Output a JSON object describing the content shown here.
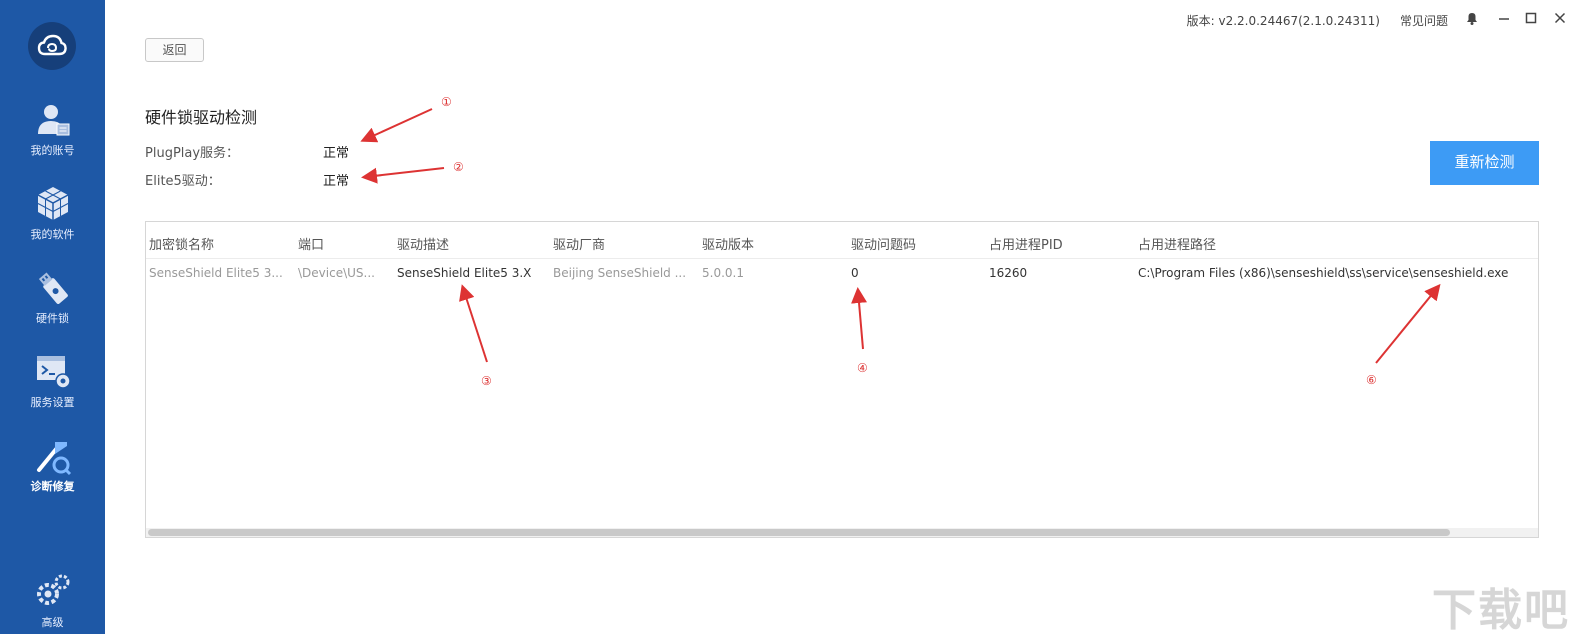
{
  "app": {
    "version": "版本: v2.2.0.24467(2.1.0.24311)",
    "faq": "常见问题"
  },
  "sidebar": {
    "items": [
      {
        "label": "我的账号",
        "icon": "user-account-icon"
      },
      {
        "label": "我的软件",
        "icon": "cube-software-icon"
      },
      {
        "label": "硬件锁",
        "icon": "usb-dongle-icon"
      },
      {
        "label": "服务设置",
        "icon": "terminal-gear-icon"
      },
      {
        "label": "诊断修复",
        "icon": "wrench-repair-icon",
        "active": true
      },
      {
        "label": "高级",
        "icon": "gears-icon"
      }
    ]
  },
  "main": {
    "back_label": "返回",
    "section_title": "硬件锁驱动检测",
    "status": [
      {
        "label": "PlugPlay服务：",
        "value": "正常"
      },
      {
        "label": "Elite5驱动：",
        "value": "正常"
      }
    ],
    "recheck_label": "重新检测"
  },
  "table": {
    "headers": [
      "加密锁名称",
      "端口",
      "驱动描述",
      "驱动厂商",
      "驱动版本",
      "驱动问题码",
      "占用进程PID",
      "占用进程路径"
    ],
    "row": [
      "SenseShield Elite5 3...",
      "\\Device\\US...",
      "SenseShield Elite5 3.X",
      "Beijing SenseShield ...",
      "5.0.0.1",
      "0",
      "16260",
      "C:\\Program Files (x86)\\senseshield\\ss\\service\\senseshield.exe"
    ]
  },
  "annotations": [
    "①",
    "②",
    "③",
    "④",
    "⑥"
  ],
  "watermark": "下载吧",
  "colors": {
    "sidebar": "#1e58a6",
    "accent_button": "#3d9bf5",
    "annotation": "#dd3333"
  }
}
